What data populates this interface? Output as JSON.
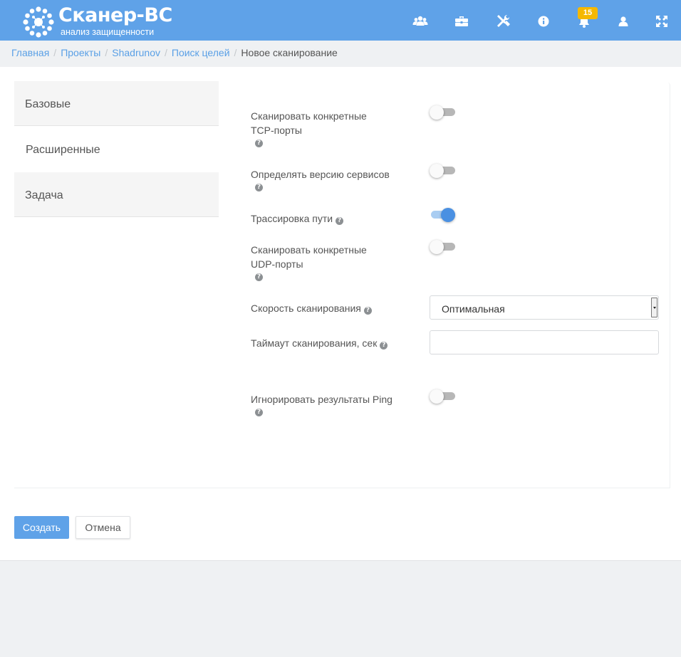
{
  "header": {
    "logo_title": "Сканер-ВС",
    "logo_subtitle": "анализ защищенности",
    "notification_count": "15",
    "icons": [
      "users-icon",
      "briefcase-icon",
      "tools-icon",
      "info-icon",
      "bell-icon",
      "user-icon",
      "fullscreen-icon"
    ]
  },
  "breadcrumb": {
    "items": [
      "Главная",
      "Проекты",
      "Shadrunov",
      "Поиск целей"
    ],
    "current": "Новое сканирование"
  },
  "tabs": [
    {
      "label": "Базовые",
      "active": false
    },
    {
      "label": "Расширенные",
      "active": true
    },
    {
      "label": "Задача",
      "active": false
    }
  ],
  "form": {
    "tcp_ports": {
      "label_1": "Сканировать конкретные",
      "label_2": "TCP-порты",
      "enabled": false
    },
    "service_version": {
      "label": "Определять версию сервисов",
      "enabled": false
    },
    "traceroute": {
      "label": "Трассировка пути",
      "enabled": true
    },
    "udp_ports": {
      "label_1": "Сканировать конкретные",
      "label_2": "UDP-порты",
      "enabled": false
    },
    "scan_speed": {
      "label": "Скорость сканирования",
      "value": "Оптимальная"
    },
    "scan_timeout": {
      "label": "Таймаут сканирования, сек",
      "value": ""
    },
    "ignore_ping": {
      "label": "Игнорировать результаты Ping",
      "enabled": false
    },
    "help_glyph": "?"
  },
  "actions": {
    "create": "Создать",
    "cancel": "Отмена"
  },
  "colors": {
    "header_bg": "#5fa2e8",
    "accent": "#4a90e2",
    "badge": "#f5b800"
  }
}
